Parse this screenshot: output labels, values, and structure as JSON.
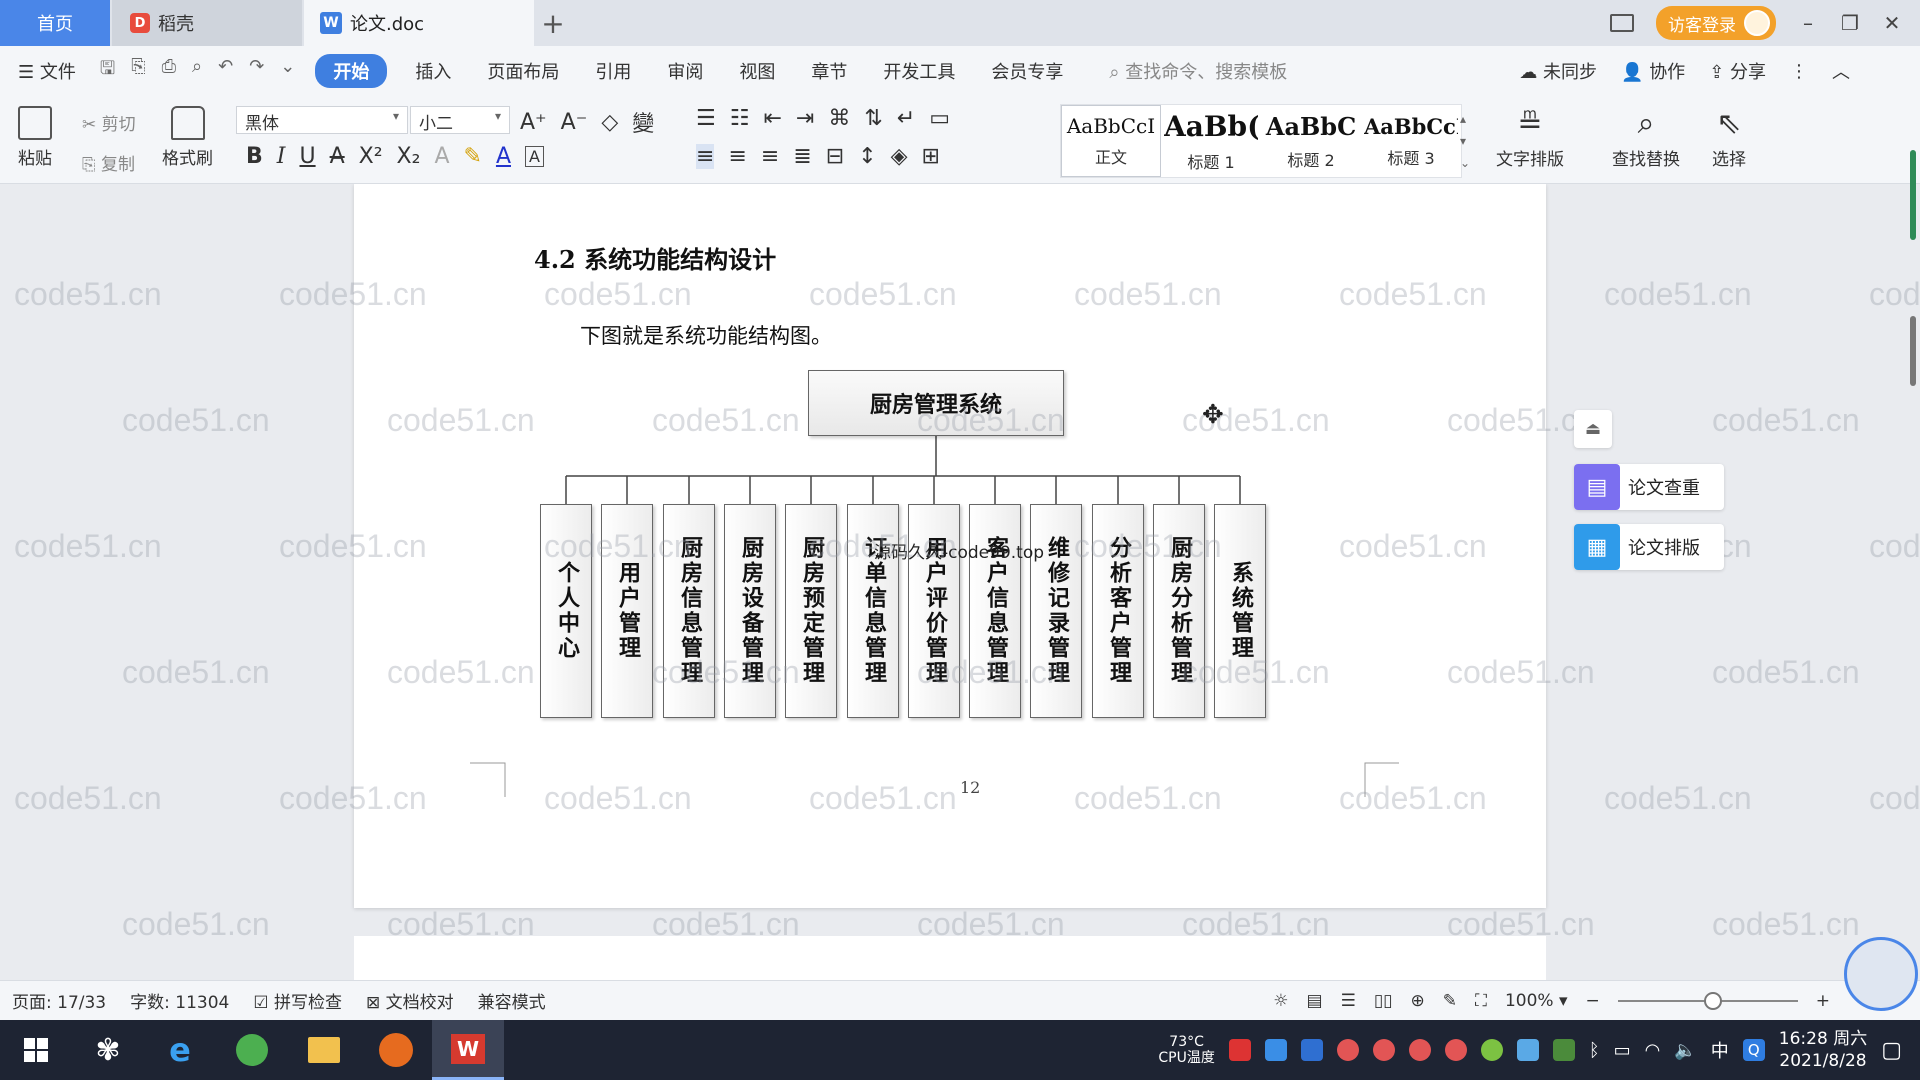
{
  "tabs": {
    "home": "首页",
    "daoke": "稻壳",
    "doc": "论文.doc",
    "new": "+"
  },
  "titlebar": {
    "login": "访客登录",
    "minimize": "–",
    "restore": "❐",
    "close": "✕"
  },
  "menu": {
    "file": "文件",
    "items": [
      "开始",
      "插入",
      "页面布局",
      "引用",
      "审阅",
      "视图",
      "章节",
      "开发工具",
      "会员专享"
    ],
    "search_placeholder": "查找命令、搜索模板",
    "unsynced": "未同步",
    "collab": "协作",
    "share": "分享"
  },
  "ribbon": {
    "paste": "粘贴",
    "cut": "剪切",
    "copy": "复制",
    "format_painter": "格式刷",
    "font_name": "黑体",
    "font_size": "小二",
    "styles": [
      {
        "sample": "AaBbCcI",
        "name": "正文",
        "heading": false
      },
      {
        "sample": "AaBb(",
        "name": "标题 1",
        "heading": true
      },
      {
        "sample": "AaBbC",
        "name": "标题 2",
        "heading": true
      },
      {
        "sample": "AaBbCcI",
        "name": "标题 3",
        "heading": true
      }
    ],
    "text_layout": "文字排版",
    "find_replace": "查找替换",
    "select": "选择"
  },
  "document": {
    "heading": "4.2 系统功能结构设计",
    "paragraph": "下图就是系统功能结构图。",
    "overlay": "源码久久-code99.top",
    "page_number": "12",
    "watermark": "code51.cn",
    "diagram": {
      "root": "厨房管理系统",
      "children": [
        "个人中心",
        "用户管理",
        "厨房信息管理",
        "厨房设备管理",
        "厨房预定管理",
        "订单信息管理",
        "用户评价管理",
        "客户信息管理",
        "维修记录管理",
        "分析客户管理",
        "厨房分析管理",
        "系统管理"
      ]
    }
  },
  "side_panel": {
    "check": "论文查重",
    "layout": "论文排版"
  },
  "status": {
    "page": "页面: 17/33",
    "words": "字数: 11304",
    "spell": "拼写检查",
    "proof": "文档校对",
    "compat": "兼容模式",
    "zoom": "100%",
    "zoom_level": 0.53
  },
  "taskbar": {
    "cpu_temp": "73°C",
    "cpu_label": "CPU温度",
    "ime": "中",
    "time": "16:28 周六",
    "date": "2021/8/28"
  },
  "colors": {
    "accent": "#3f7fe0",
    "home_tab": "#4a86e8",
    "login": "#f3a12a",
    "taskbar": "#1e2433"
  }
}
